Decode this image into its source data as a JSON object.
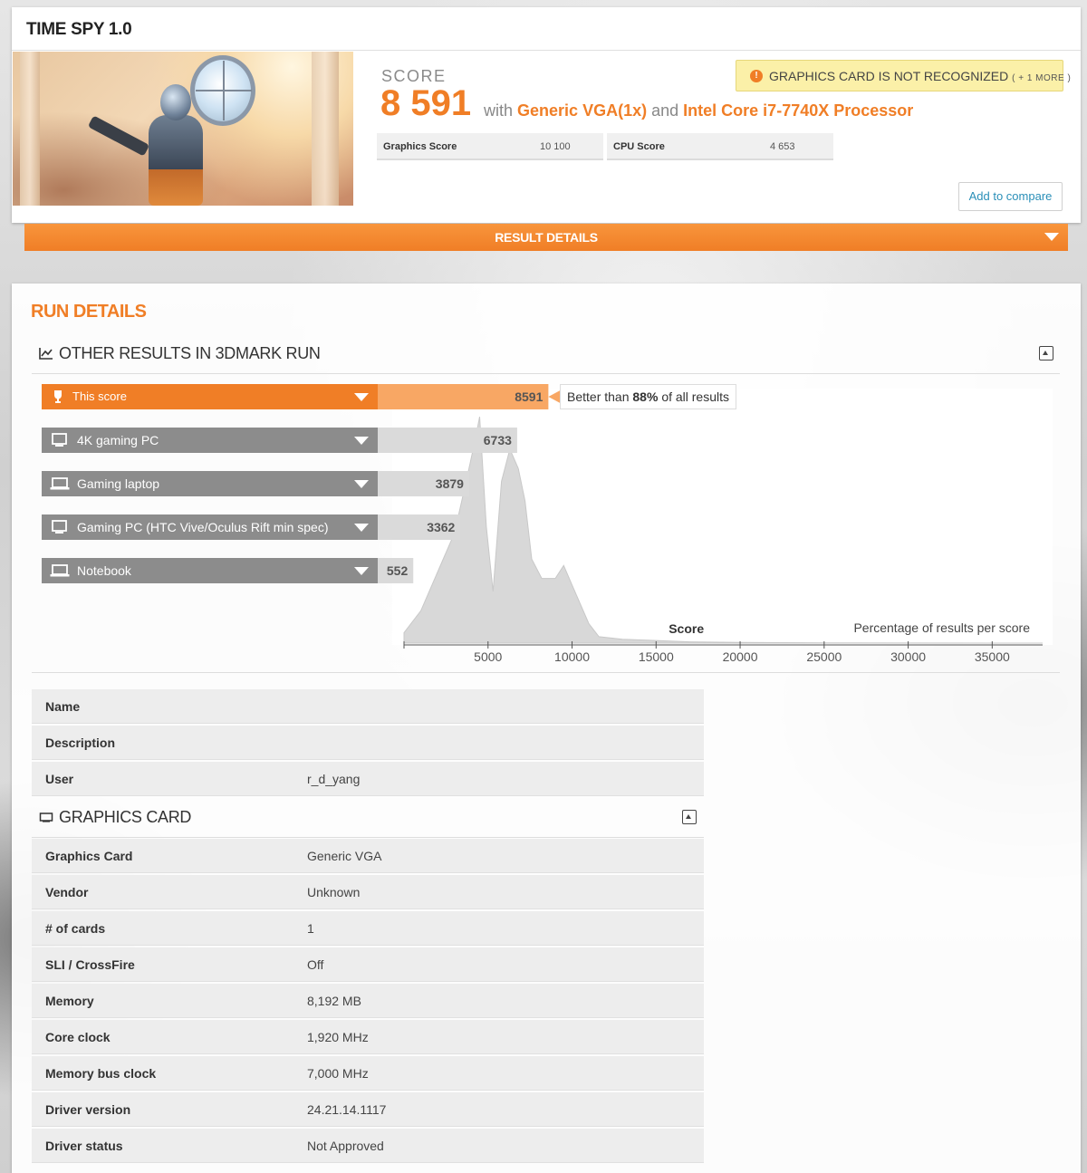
{
  "test": {
    "title": "TIME SPY 1.0",
    "score_label": "SCORE",
    "score": "8 591",
    "with_text": "with",
    "gpu_text": "Generic VGA(1x)",
    "and_text": "and",
    "cpu_text": "Intel Core i7-7740X Processor",
    "graphics_score_label": "Graphics Score",
    "graphics_score": "10 100",
    "cpu_score_label": "CPU Score",
    "cpu_score": "4 653",
    "warning_icon": "!",
    "warning": "GRAPHICS CARD IS NOT RECOGNIZED",
    "warning_more": "( + 1 MORE )",
    "compare_button": "Add to compare",
    "result_details": "RESULT DETAILS"
  },
  "run_details": {
    "title": "RUN DETAILS",
    "other_results_title": "OTHER RESULTS IN 3DMARK RUN",
    "better_than_prefix": "Better than",
    "better_than_pct": "88%",
    "better_than_suffix": "of all results",
    "chart_caption_score": "Score",
    "chart_caption_pct": "Percentage of results per score",
    "info": [
      {
        "key": "Name",
        "value": ""
      },
      {
        "key": "Description",
        "value": ""
      },
      {
        "key": "User",
        "value": "r_d_yang"
      }
    ]
  },
  "graphics_card": {
    "title": "GRAPHICS CARD",
    "rows": [
      {
        "key": "Graphics Card",
        "value": "Generic VGA"
      },
      {
        "key": "Vendor",
        "value": "Unknown"
      },
      {
        "key": "# of cards",
        "value": "1"
      },
      {
        "key": "SLI / CrossFire",
        "value": "Off"
      },
      {
        "key": "Memory",
        "value": "8,192 MB"
      },
      {
        "key": "Core clock",
        "value": "1,920 MHz"
      },
      {
        "key": "Memory bus clock",
        "value": "7,000 MHz"
      },
      {
        "key": "Driver version",
        "value": "24.21.14.1117"
      },
      {
        "key": "Driver status",
        "value": "Not Approved"
      }
    ]
  },
  "chart_data": {
    "type": "area",
    "xlabel": "Score",
    "ylabel": "Percentage of results per score",
    "xlim": [
      0,
      38000
    ],
    "xticks": [
      5000,
      10000,
      15000,
      20000,
      25000,
      30000,
      35000
    ],
    "comparisons": [
      {
        "name": "This score",
        "value": 8591,
        "highlight": true,
        "icon": "trophy-icon"
      },
      {
        "name": "4K gaming PC",
        "value": 6733,
        "icon": "monitor-icon"
      },
      {
        "name": "Gaming laptop",
        "value": 3879,
        "icon": "laptop-icon"
      },
      {
        "name": "Gaming PC (HTC Vive/Oculus Rift min spec)",
        "value": 3362,
        "icon": "monitor-icon"
      },
      {
        "name": "Notebook",
        "value": 552,
        "icon": "laptop-icon"
      }
    ],
    "distribution": {
      "x": [
        0,
        1000,
        2000,
        3000,
        3700,
        4200,
        4500,
        4900,
        5300,
        5800,
        6300,
        6800,
        7200,
        7600,
        8200,
        9000,
        9500,
        10000,
        10500,
        11000,
        11600,
        13000,
        15000,
        17000,
        20000,
        25000,
        30000,
        35000,
        38000
      ],
      "y": [
        0.8,
        2.5,
        5.5,
        8.5,
        12.5,
        15.5,
        17.5,
        9.0,
        4.0,
        12.5,
        15.0,
        13.5,
        11.0,
        6.5,
        5.0,
        5.0,
        6.0,
        4.5,
        3.0,
        1.5,
        0.5,
        0.3,
        0.2,
        0.1,
        0.05,
        0.02,
        0.01,
        0.0,
        0.0
      ]
    },
    "colors": {
      "accent": "#f07e26",
      "comparison": "#8c8c8c",
      "area": "#d8d8d8"
    }
  }
}
